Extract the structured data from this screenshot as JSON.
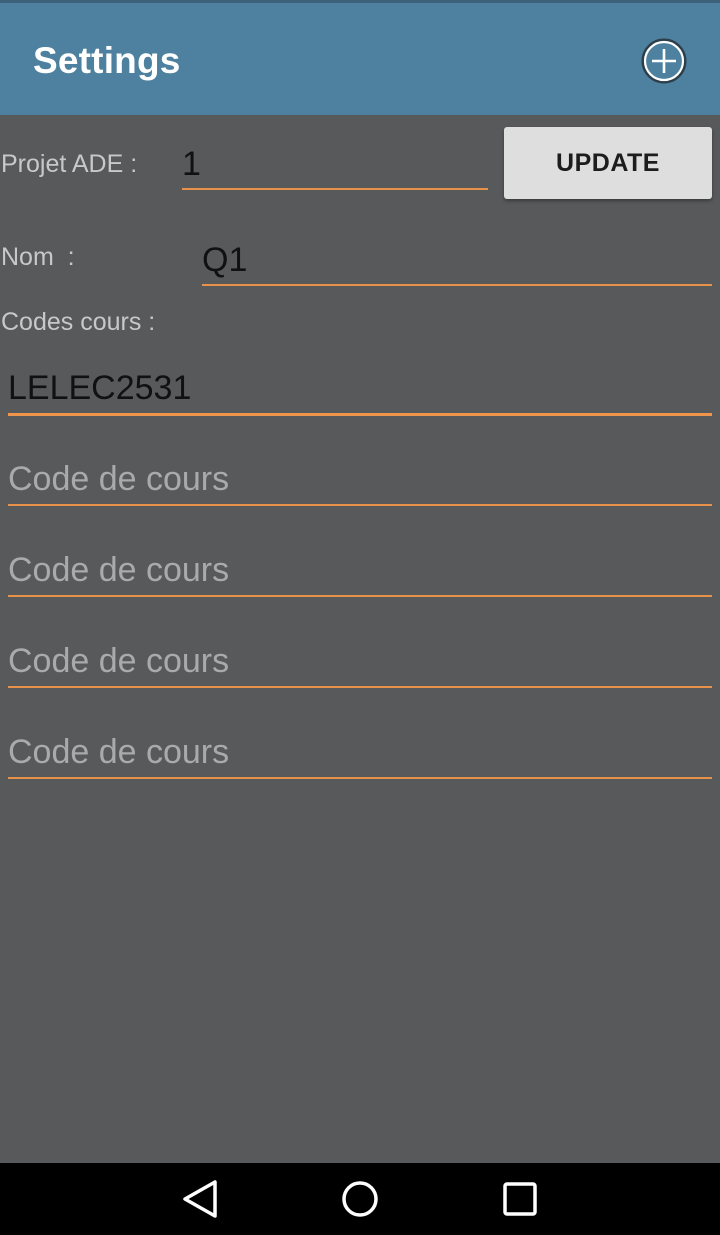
{
  "app_bar": {
    "title": "Settings",
    "add_icon": "plus-circle-icon",
    "color": "#4d819f"
  },
  "form": {
    "projet_ade": {
      "label": "Projet ADE :",
      "value": "1"
    },
    "update_button": {
      "label": "UPDATE"
    },
    "nom": {
      "label": "Nom  :",
      "value": "Q1"
    },
    "codes_cours": {
      "label": "Codes cours :",
      "fields": [
        {
          "value": "LELEC2531",
          "placeholder": "Code de cours"
        },
        {
          "value": "",
          "placeholder": "Code de cours"
        },
        {
          "value": "",
          "placeholder": "Code de cours"
        },
        {
          "value": "",
          "placeholder": "Code de cours"
        },
        {
          "value": "",
          "placeholder": "Code de cours"
        }
      ]
    },
    "accent_color": "#e8914a",
    "background_color": "#58595b"
  },
  "nav_bar": {
    "back_icon": "triangle-back-icon",
    "home_icon": "circle-home-icon",
    "recents_icon": "square-recents-icon"
  }
}
